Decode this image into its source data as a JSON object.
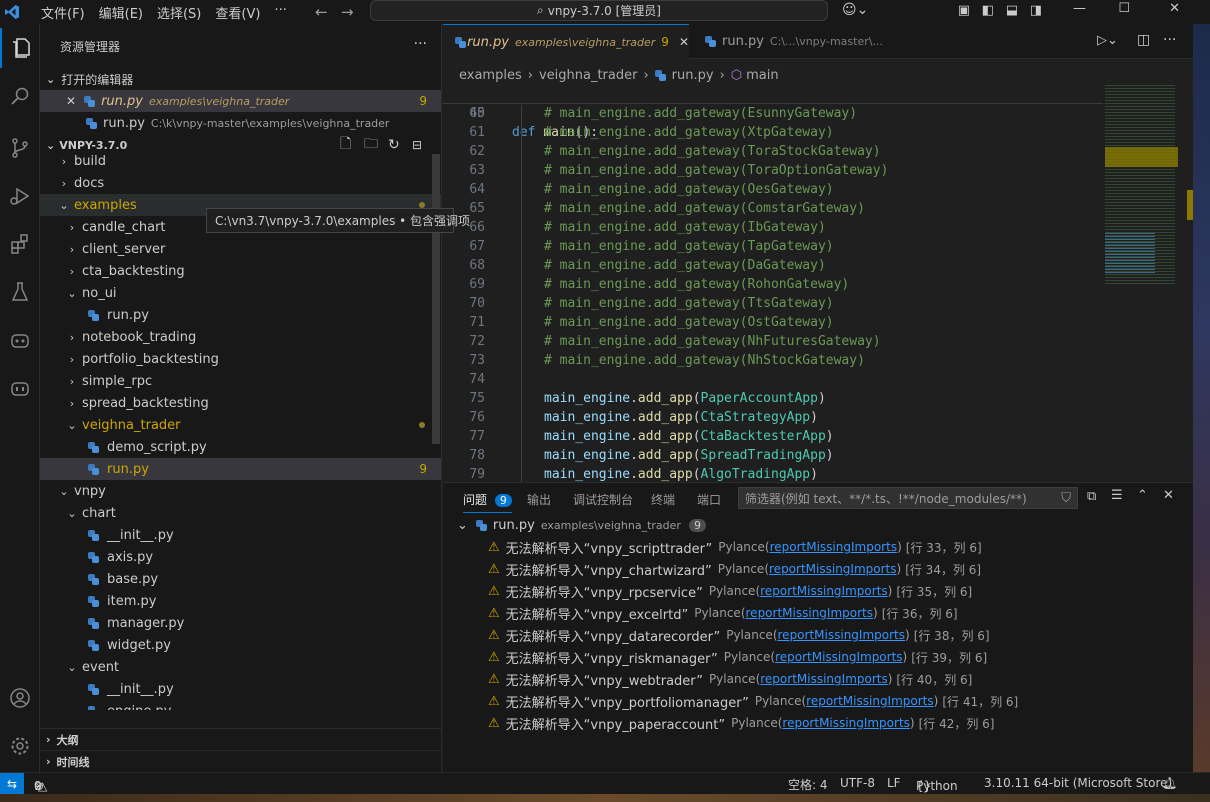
{
  "titlebar": {
    "menu": [
      "文件(F)",
      "编辑(E)",
      "选择(S)",
      "查看(V)",
      "···"
    ],
    "command_center": "vnpy-3.7.0 [管理员]"
  },
  "sidebar": {
    "title": "资源管理器",
    "open_editors_label": "打开的编辑器",
    "open_editors": [
      {
        "name": "run.py",
        "path": "examples\\veighna_trader",
        "badge": "9"
      },
      {
        "name": "run.py",
        "path": "C:\\k\\vnpy-master\\examples\\veighna_trader"
      }
    ],
    "project_label": "VNPY-3.7.0",
    "tree": [
      {
        "label": "build",
        "kind": "folder",
        "depth": 0
      },
      {
        "label": "docs",
        "kind": "folder",
        "depth": 0
      },
      {
        "label": "examples",
        "kind": "folder-open",
        "depth": 0
      },
      {
        "label": "candle_chart",
        "kind": "folder",
        "depth": 1
      },
      {
        "label": "client_server",
        "kind": "folder",
        "depth": 1
      },
      {
        "label": "cta_backtesting",
        "kind": "folder",
        "depth": 1
      },
      {
        "label": "no_ui",
        "kind": "folder-open",
        "depth": 1
      },
      {
        "label": "run.py",
        "kind": "file",
        "depth": 2
      },
      {
        "label": "notebook_trading",
        "kind": "folder",
        "depth": 1
      },
      {
        "label": "portfolio_backtesting",
        "kind": "folder",
        "depth": 1
      },
      {
        "label": "simple_rpc",
        "kind": "folder",
        "depth": 1
      },
      {
        "label": "spread_backtesting",
        "kind": "folder",
        "depth": 1
      },
      {
        "label": "veighna_trader",
        "kind": "folder-open",
        "depth": 1
      },
      {
        "label": "demo_script.py",
        "kind": "file",
        "depth": 2
      },
      {
        "label": "run.py",
        "kind": "file",
        "depth": 2,
        "badge": "9"
      },
      {
        "label": "vnpy",
        "kind": "folder-open",
        "depth": 0
      },
      {
        "label": "chart",
        "kind": "folder-open",
        "depth": 1
      },
      {
        "label": "__init__.py",
        "kind": "file",
        "depth": 2
      },
      {
        "label": "axis.py",
        "kind": "file",
        "depth": 2
      },
      {
        "label": "base.py",
        "kind": "file",
        "depth": 2
      },
      {
        "label": "item.py",
        "kind": "file",
        "depth": 2
      },
      {
        "label": "manager.py",
        "kind": "file",
        "depth": 2
      },
      {
        "label": "widget.py",
        "kind": "file",
        "depth": 2
      },
      {
        "label": "event",
        "kind": "folder-open",
        "depth": 1
      },
      {
        "label": "__init__.py",
        "kind": "file",
        "depth": 2
      },
      {
        "label": "engine.py",
        "kind": "file",
        "depth": 2
      },
      {
        "label": "rpc",
        "kind": "folder",
        "depth": 1
      }
    ],
    "tooltip": "C:\\vn3.7\\vnpy-3.7.0\\examples • 包含强调项",
    "outline_label": "大纲",
    "timeline_label": "时间线"
  },
  "tabs": [
    {
      "name": "run.py",
      "path": "examples\\veighna_trader",
      "badge": "9"
    },
    {
      "name": "run.py",
      "path": "C:\\...\\vnpy-master\\..."
    }
  ],
  "breadcrumb": [
    "examples",
    "veighna_trader",
    "run.py",
    "main"
  ],
  "code": {
    "sticky": {
      "line": "45",
      "text": "def main():"
    },
    "comment_lines": [
      {
        "n": "60",
        "gw": "EsunnyGateway"
      },
      {
        "n": "61",
        "gw": "XtpGateway"
      },
      {
        "n": "62",
        "gw": "ToraStockGateway"
      },
      {
        "n": "63",
        "gw": "ToraOptionGateway"
      },
      {
        "n": "64",
        "gw": "OesGateway"
      },
      {
        "n": "65",
        "gw": "ComstarGateway"
      },
      {
        "n": "66",
        "gw": "IbGateway"
      },
      {
        "n": "67",
        "gw": "TapGateway"
      },
      {
        "n": "68",
        "gw": "DaGateway"
      },
      {
        "n": "69",
        "gw": "RohonGateway"
      },
      {
        "n": "70",
        "gw": "TtsGateway"
      },
      {
        "n": "71",
        "gw": "OstGateway"
      },
      {
        "n": "72",
        "gw": "NhFuturesGateway"
      },
      {
        "n": "73",
        "gw": "NhStockGateway"
      }
    ],
    "blank_line": "74",
    "app_lines": [
      {
        "n": "75",
        "app": "PaperAccountApp"
      },
      {
        "n": "76",
        "app": "CtaStrategyApp"
      },
      {
        "n": "77",
        "app": "CtaBacktesterApp"
      },
      {
        "n": "78",
        "app": "SpreadTradingApp"
      },
      {
        "n": "79",
        "app": "AlgoTradingApp"
      }
    ]
  },
  "panel": {
    "tabs": [
      "问题",
      "输出",
      "调试控制台",
      "终端",
      "端口"
    ],
    "problems_count": "9",
    "filter_placeholder": "筛选器(例如 text、**/*.ts、!**/node_modules/**)",
    "file": {
      "name": "run.py",
      "path": "examples\\veighna_trader",
      "count": "9"
    },
    "problems": [
      {
        "msg": "无法解析导入“vnpy_scripttrader”",
        "src": "Pylance",
        "rule": "reportMissingImports",
        "pos": "[行 33，列 6]"
      },
      {
        "msg": "无法解析导入“vnpy_chartwizard”",
        "src": "Pylance",
        "rule": "reportMissingImports",
        "pos": "[行 34，列 6]"
      },
      {
        "msg": "无法解析导入“vnpy_rpcservice”",
        "src": "Pylance",
        "rule": "reportMissingImports",
        "pos": "[行 35，列 6]"
      },
      {
        "msg": "无法解析导入“vnpy_excelrtd”",
        "src": "Pylance",
        "rule": "reportMissingImports",
        "pos": "[行 36，列 6]"
      },
      {
        "msg": "无法解析导入“vnpy_datarecorder”",
        "src": "Pylance",
        "rule": "reportMissingImports",
        "pos": "[行 38，列 6]"
      },
      {
        "msg": "无法解析导入“vnpy_riskmanager”",
        "src": "Pylance",
        "rule": "reportMissingImports",
        "pos": "[行 39，列 6]"
      },
      {
        "msg": "无法解析导入“vnpy_webtrader”",
        "src": "Pylance",
        "rule": "reportMissingImports",
        "pos": "[行 40，列 6]"
      },
      {
        "msg": "无法解析导入“vnpy_portfoliomanager”",
        "src": "Pylance",
        "rule": "reportMissingImports",
        "pos": "[行 41，列 6]"
      },
      {
        "msg": "无法解析导入“vnpy_paperaccount”",
        "src": "Pylance",
        "rule": "reportMissingImports",
        "pos": "[行 42，列 6]"
      }
    ]
  },
  "status": {
    "errors": "0",
    "warnings": "9",
    "spaces": "空格: 4",
    "encoding": "UTF-8",
    "eol": "LF",
    "language": "Python",
    "interpreter": "3.10.11 64-bit (Microsoft Store)"
  },
  "colors": {
    "accent": "#0078d4",
    "warning": "#cca700",
    "comment": "#6a9955",
    "link": "#3794ff"
  }
}
